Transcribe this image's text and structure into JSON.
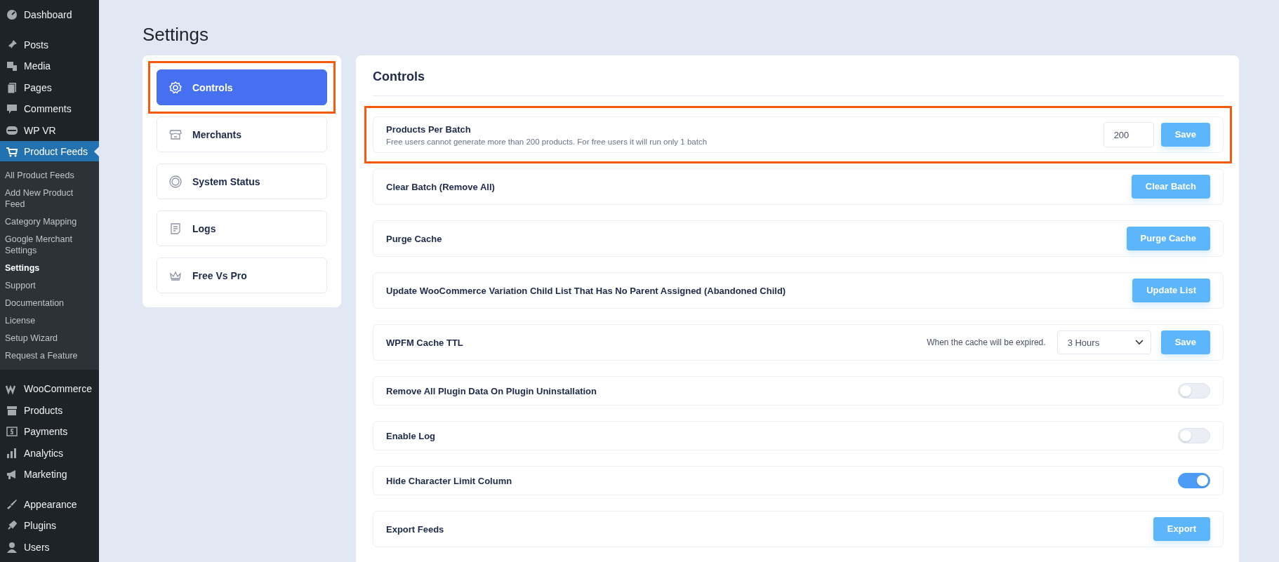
{
  "admin_menu": {
    "groups": [
      {
        "items": [
          {
            "label": "Dashboard",
            "selected": false
          }
        ]
      },
      {
        "items": [
          {
            "label": "Posts",
            "selected": false
          },
          {
            "label": "Media",
            "selected": false
          },
          {
            "label": "Pages",
            "selected": false
          },
          {
            "label": "Comments",
            "selected": false
          },
          {
            "label": "WP VR",
            "selected": false
          },
          {
            "label": "Product Feeds",
            "selected": true,
            "children": [
              {
                "label": "All Product Feeds",
                "selected": false
              },
              {
                "label": "Add New Product Feed",
                "selected": false
              },
              {
                "label": "Category Mapping",
                "selected": false
              },
              {
                "label": "Google Merchant Settings",
                "selected": false
              },
              {
                "label": "Settings",
                "selected": true
              },
              {
                "label": "Support",
                "selected": false
              },
              {
                "label": "Documentation",
                "selected": false
              },
              {
                "label": "License",
                "selected": false
              },
              {
                "label": "Setup Wizard",
                "selected": false
              },
              {
                "label": "Request a Feature",
                "selected": false
              }
            ]
          }
        ]
      },
      {
        "items": [
          {
            "label": "WooCommerce",
            "selected": false
          },
          {
            "label": "Products",
            "selected": false
          },
          {
            "label": "Payments",
            "selected": false
          },
          {
            "label": "Analytics",
            "selected": false
          },
          {
            "label": "Marketing",
            "selected": false
          }
        ]
      },
      {
        "items": [
          {
            "label": "Appearance",
            "selected": false
          },
          {
            "label": "Plugins",
            "selected": false
          },
          {
            "label": "Users",
            "selected": false
          }
        ]
      }
    ]
  },
  "page_title": "Settings",
  "settings_nav": [
    {
      "label": "Controls",
      "selected": true,
      "highlighted": true
    },
    {
      "label": "Merchants",
      "selected": false,
      "highlighted": false
    },
    {
      "label": "System Status",
      "selected": false,
      "highlighted": false
    },
    {
      "label": "Logs",
      "selected": false,
      "highlighted": false
    },
    {
      "label": "Free Vs Pro",
      "selected": false,
      "highlighted": false
    }
  ],
  "panel": {
    "title": "Controls",
    "rows": [
      {
        "kind": "input",
        "label": "Products Per Batch",
        "description": "Free users cannot generate more than 200 products. For free users it will run only 1 batch",
        "value": "200",
        "button": "Save",
        "highlighted": true
      },
      {
        "kind": "button",
        "label": "Clear Batch (Remove All)",
        "button": "Clear Batch",
        "highlighted": false
      },
      {
        "kind": "button",
        "label": "Purge Cache",
        "button": "Purge Cache",
        "highlighted": false
      },
      {
        "kind": "button",
        "label": "Update WooCommerce Variation Child List That Has No Parent Assigned (Abandoned Child)",
        "button": "Update List",
        "highlighted": false
      },
      {
        "kind": "select",
        "label": "WPFM Cache TTL",
        "hint": "When the cache will be expired.",
        "value": "3 Hours",
        "button": "Save",
        "highlighted": false
      },
      {
        "kind": "toggle",
        "label": "Remove All Plugin Data On Plugin Uninstallation",
        "on": false,
        "highlighted": false
      },
      {
        "kind": "toggle",
        "label": "Enable Log",
        "on": false,
        "highlighted": false
      },
      {
        "kind": "toggle",
        "label": "Hide Character Limit Column",
        "on": true,
        "highlighted": false
      },
      {
        "kind": "button",
        "label": "Export Feeds",
        "button": "Export",
        "highlighted": false
      }
    ]
  }
}
